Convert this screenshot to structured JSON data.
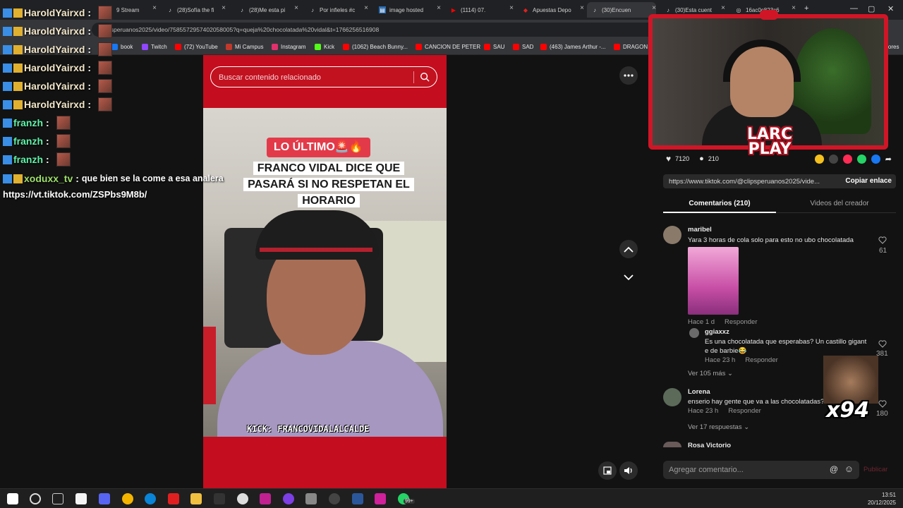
{
  "browser": {
    "tabs": [
      {
        "label": "9 Stream"
      },
      {
        "label": "(28)Sofía the fi"
      },
      {
        "label": "(28)Me esta pi"
      },
      {
        "label": "Por infieles #c"
      },
      {
        "label": "image hosted"
      },
      {
        "label": "(1114) 07."
      },
      {
        "label": "Apuestas Depo"
      },
      {
        "label": "(30)Encuen"
      },
      {
        "label": "(30)Esta cuent"
      },
      {
        "label": "16ac0c823c6"
      }
    ],
    "url": "psperuanos2025/video/7585572957402058005?q=queja%20chocolatada%20vidal&t=1766256516908",
    "bookmarks": [
      {
        "label": "book",
        "color": "#1877f2"
      },
      {
        "label": "Twitch",
        "color": "#9146ff"
      },
      {
        "label": "(72) YouTube",
        "color": "#ff0000"
      },
      {
        "label": "Mi Campus",
        "color": "#c0392b"
      },
      {
        "label": "Instagram",
        "color": "#e1306c"
      },
      {
        "label": "Kick",
        "color": "#53fc18"
      },
      {
        "label": "(1062) Beach Bunny...",
        "color": "#ff0000"
      },
      {
        "label": "CANCION DE PETER",
        "color": "#ff0000"
      },
      {
        "label": "SAU",
        "color": "#ff0000"
      },
      {
        "label": "SAD",
        "color": "#ff0000"
      },
      {
        "label": "(463) James Arthur -...",
        "color": "#ff0000"
      },
      {
        "label": "DRAGON BA",
        "color": "#ff0000"
      }
    ],
    "bookmarks_right": "adores"
  },
  "chat": {
    "lines": [
      {
        "user": "HaroldYairxd",
        "sep": ":",
        "text": "",
        "emote": true,
        "color": "harold"
      },
      {
        "user": "HaroldYairxd",
        "sep": ":",
        "text": "",
        "emote": true,
        "color": "harold"
      },
      {
        "user": "HaroldYairxd",
        "sep": ":",
        "text": "",
        "emote": true,
        "color": "harold"
      },
      {
        "user": "HaroldYairxd",
        "sep": ":",
        "text": "",
        "emote": true,
        "color": "harold"
      },
      {
        "user": "HaroldYairxd",
        "sep": ":",
        "text": "",
        "emote": true,
        "color": "harold"
      },
      {
        "user": "HaroldYairxd",
        "sep": ":",
        "text": "",
        "emote": true,
        "color": "harold"
      },
      {
        "user": "franzh",
        "sep": ":",
        "text": "",
        "emote": true,
        "color": "franz"
      },
      {
        "user": "franzh",
        "sep": ":",
        "text": "",
        "emote": true,
        "color": "franz"
      },
      {
        "user": "franzh",
        "sep": ":",
        "text": "",
        "emote": true,
        "color": "franz"
      },
      {
        "user": "xoduxx_tv",
        "sep": ":",
        "text": "que bien se la come a esa analera",
        "emote": false,
        "color": "xod"
      }
    ],
    "link_line": "https://vt.tiktok.com/ZSPbs9M8b/"
  },
  "search": {
    "placeholder": "Buscar contenido relacionado"
  },
  "video": {
    "tag": "LO ÚLTIMO🚨🔥",
    "headline": "FRANCO VIDAL DICE QUE PASARÁ SI NO RESPETAN EL HORARIO",
    "caption": "KICK: FRANCOVIDALALCALDE"
  },
  "actions": {
    "likes": "7120",
    "comments": "210"
  },
  "link": {
    "url": "https://www.tiktok.com/@clipsperuanos2025/vide...",
    "copy_label": "Copiar enlace"
  },
  "tabs": {
    "comments": "Comentarios (210)",
    "creator": "Videos del creador"
  },
  "comments": [
    {
      "name": "maribel",
      "text": "Yara 3 horas de cola solo para esto no ubo chocolatada",
      "time": "Hace 1 d",
      "reply": "Responder",
      "likes": "61"
    },
    {
      "name": "ggiaxxz",
      "text": "Es una chocolatada que esperabas? Un castillo gigant e de barbie😂",
      "time": "Hace 23 h",
      "reply": "Responder",
      "likes": "381"
    },
    {
      "name": "Lorena",
      "text": "enserio hay gente que va a las chocolatadas?",
      "time": "Hace 23 h",
      "reply": "Responder",
      "likes": "180"
    },
    {
      "name": "Rosa Victorio"
    }
  ],
  "more_replies": [
    "Ver 105 más",
    "Ver 17 respuestas"
  ],
  "composer": {
    "placeholder": "Agregar comentario...",
    "post_label": "Publicar"
  },
  "overlay": {
    "brand_line1": "LARC",
    "brand_line2": "PLAY",
    "meme_text": "x94"
  },
  "system": {
    "time": "13:51",
    "date": "20/12/2025",
    "notif_badge": "99+"
  }
}
